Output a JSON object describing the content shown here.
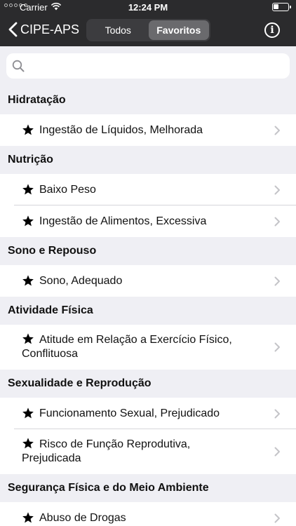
{
  "status_bar": {
    "carrier": "Carrier",
    "time": "12:24 PM",
    "battery_level": 0.35
  },
  "nav": {
    "back_label": "CIPE-APS",
    "segments": [
      {
        "label": "Todos",
        "selected": false
      },
      {
        "label": "Favoritos",
        "selected": true
      }
    ],
    "info_glyph": "i"
  },
  "search": {
    "placeholder": "",
    "value": ""
  },
  "sections": [
    {
      "title": "Hidratação",
      "items": [
        {
          "lines": [
            "Ingestão de Líquidos, Melhorada"
          ]
        }
      ]
    },
    {
      "title": "Nutrição",
      "items": [
        {
          "lines": [
            "Baixo Peso"
          ]
        },
        {
          "lines": [
            "Ingestão de Alimentos, Excessiva"
          ]
        }
      ]
    },
    {
      "title": "Sono e Repouso",
      "items": [
        {
          "lines": [
            "Sono, Adequado"
          ]
        }
      ]
    },
    {
      "title": "Atividade Física",
      "items": [
        {
          "lines": [
            "Atitude em Relação a Exercício Físico,",
            "Conflituosa"
          ]
        }
      ]
    },
    {
      "title": "Sexualidade e Reprodução",
      "items": [
        {
          "lines": [
            "Funcionamento Sexual, Prejudicado"
          ]
        },
        {
          "lines": [
            "Risco de Função Reprodutiva,",
            "Prejudicada"
          ]
        }
      ]
    },
    {
      "title": "Segurança Física e do Meio Ambiente",
      "items": [
        {
          "lines": [
            "Abuso de Drogas"
          ]
        }
      ]
    }
  ],
  "colors": {
    "nav_background": "#2b2b2d",
    "section_background": "#efeff4",
    "chevron": "#c4c4c8"
  },
  "icons": {
    "favorite": "star-icon",
    "disclosure": "chevron-right-icon",
    "search": "magnifier-icon",
    "back": "chevron-left-icon",
    "info": "info-icon"
  }
}
